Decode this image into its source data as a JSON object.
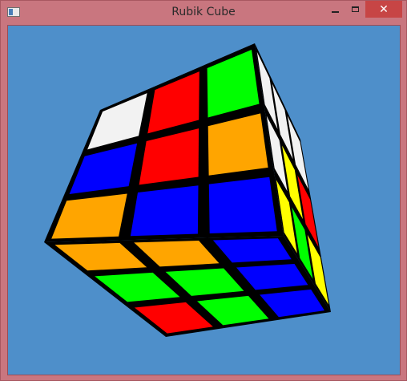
{
  "window": {
    "title": "Rubik Cube",
    "close_glyph": "✕"
  },
  "colors": {
    "frame": "#c9767f",
    "viewport_background": "#4e8fca",
    "white": "#f2f2f2",
    "red": "#ff0000",
    "green": "#00ff00",
    "orange": "#ffa500",
    "blue": "#0000ff",
    "yellow": "#ffff00",
    "body": "#000000"
  },
  "cube": {
    "front_face": [
      [
        "white",
        "red",
        "green"
      ],
      [
        "blue",
        "red",
        "orange"
      ],
      [
        "orange",
        "blue",
        "blue"
      ]
    ],
    "bottom_face": [
      [
        "orange",
        "orange",
        "blue"
      ],
      [
        "green",
        "green",
        "blue"
      ],
      [
        "red",
        "green",
        "blue"
      ]
    ],
    "right_face": [
      [
        "white",
        "white",
        "white"
      ],
      [
        "white",
        "yellow",
        "red"
      ],
      [
        "yellow",
        "green",
        "yellow"
      ]
    ]
  }
}
